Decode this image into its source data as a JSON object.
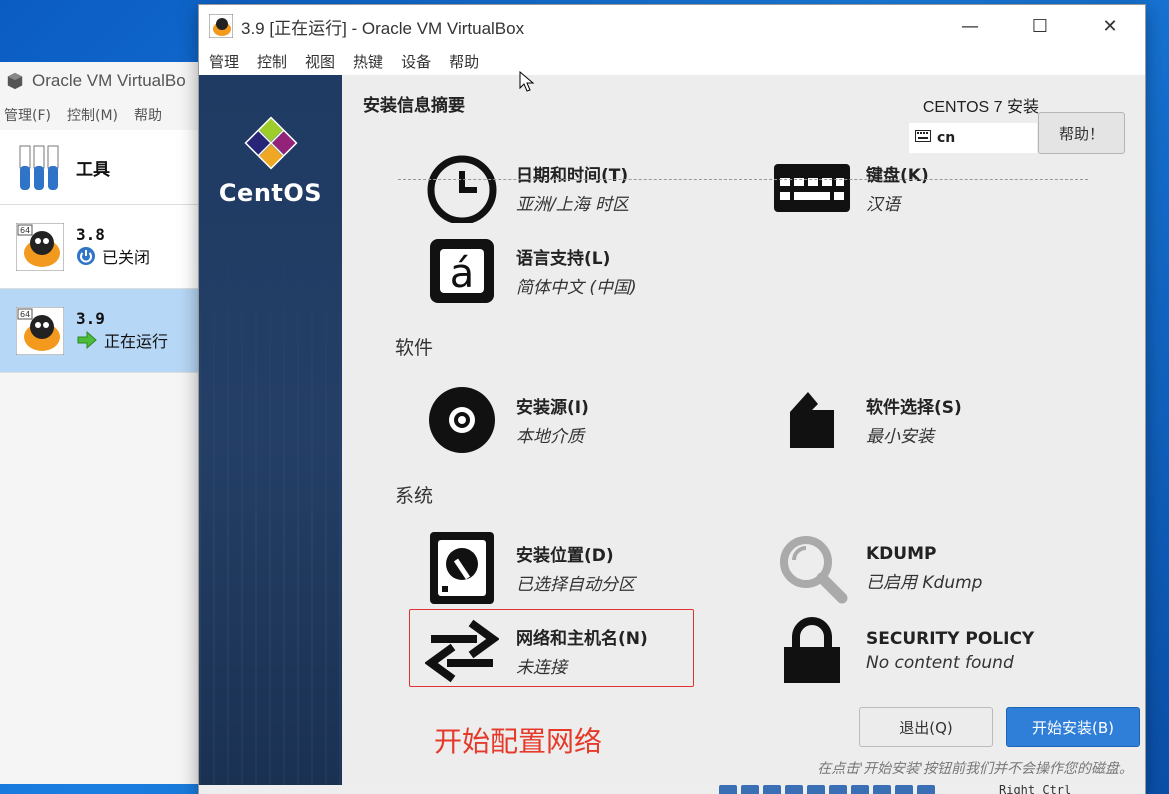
{
  "manager": {
    "title": "Oracle VM VirtualBo",
    "menu": [
      "管理(F)",
      "控制(M)",
      "帮助"
    ],
    "tools_label": "工具",
    "vms": [
      {
        "name": "3.8",
        "state": "已关闭",
        "state_icon": "power-icon",
        "selected": false
      },
      {
        "name": "3.9",
        "state": "正在运行",
        "state_icon": "running-arrow-icon",
        "selected": true
      }
    ]
  },
  "vm_window": {
    "title": "3.9 [正在运行] - Oracle VM VirtualBox",
    "menu": [
      "管理",
      "控制",
      "视图",
      "热键",
      "设备",
      "帮助"
    ],
    "controls": {
      "minimize": "—",
      "maximize": "☐",
      "close": "✕"
    }
  },
  "installer": {
    "brand": "CentOS",
    "summary_title": "安装信息摘要",
    "product_title": "CENTOS 7 安装",
    "keyboard_layout": "cn",
    "help_button": "帮助！",
    "localization_items": [
      {
        "title": "日期和时间(T)",
        "status": "亚洲/上海 时区",
        "icon": "clock-icon"
      },
      {
        "title": "键盘(K)",
        "status": "汉语",
        "icon": "keyboard-icon"
      },
      {
        "title": "语言支持(L)",
        "status": "简体中文 (中国)",
        "icon": "language-icon"
      }
    ],
    "software_label": "软件",
    "software_items": [
      {
        "title": "安装源(I)",
        "status": "本地介质",
        "icon": "disc-icon"
      },
      {
        "title": "软件选择(S)",
        "status": "最小安装",
        "icon": "package-icon"
      }
    ],
    "system_label": "系统",
    "system_items": [
      {
        "title": "安装位置(D)",
        "status": "已选择自动分区",
        "icon": "harddisk-icon"
      },
      {
        "title": "KDUMP",
        "status": "已启用 Kdump",
        "icon": "kdump-search-icon"
      },
      {
        "title": "网络和主机名(N)",
        "status": "未连接",
        "icon": "network-arrows-icon"
      },
      {
        "title": "SECURITY POLICY",
        "status": "No content found",
        "icon": "lock-icon"
      }
    ],
    "quit_button": "退出(Q)",
    "begin_button": "开始安装(B)",
    "footnote": "在点击'开始安装'按钮前我们并不会操作您的磁盘。"
  },
  "annotation": {
    "text": "开始配置网络",
    "color": "#e53a2a"
  },
  "statusbar": {
    "host_key": "Right Ctrl"
  },
  "colors": {
    "sidebar": "#1f3b63",
    "primary_button": "#2f7ed8",
    "highlight": "#dd3333"
  }
}
